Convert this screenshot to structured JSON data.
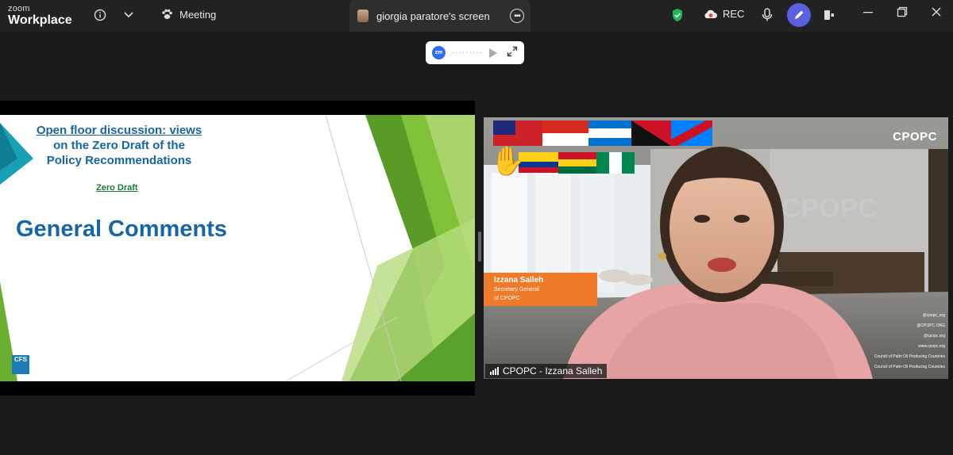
{
  "app": {
    "logo_line1": "zoom",
    "logo_line2": "Workplace",
    "meeting_label": "Meeting",
    "share_tab_label": "giorgia paratore's screen",
    "rec_label": "REC"
  },
  "floating_control": {
    "badge": "zm",
    "dots": "·········"
  },
  "slide": {
    "title_line1": "Open floor discussion: views",
    "title_line2": "on the Zero Draft of the",
    "title_line3": "Policy Recommendations",
    "link": "Zero Draft",
    "heading": "General Comments",
    "logo": "CFS"
  },
  "video": {
    "brand": "CPOPC",
    "wall_brand": "CPOPC",
    "lower_third_name": "Izzana Salleh",
    "lower_third_role_1": "Secretary General",
    "lower_third_role_2": "of CPOPC",
    "participant_label": "CPOPC - Izzana Salleh",
    "socials": [
      "@cpopc_org",
      "@CPOPC.ORG",
      "@cpopc.org",
      "www.cpopc.org",
      "Council of Palm Oil Producing Countries",
      "Council of Palm Oil Producing Countries"
    ]
  },
  "colors": {
    "accent_blue": "#1565a8",
    "slide_green": "#6cae2f",
    "lower_third": "#ee7a2a",
    "annotate": "#5a5fe0",
    "rec": "#e8453c"
  }
}
